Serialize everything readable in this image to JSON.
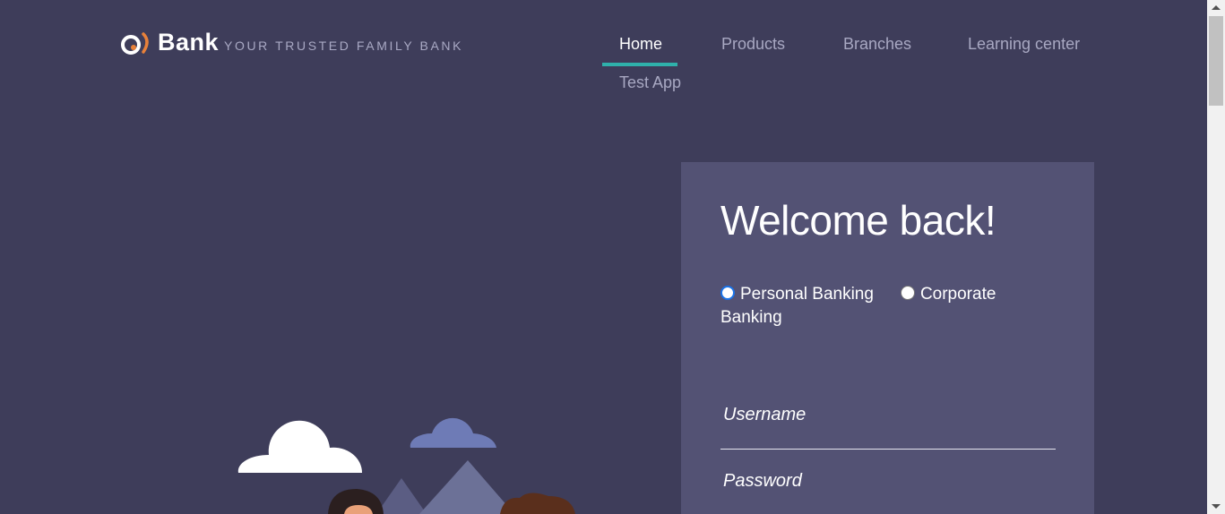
{
  "brand": {
    "name": "Bank",
    "tagline": "YOUR TRUSTED FAMILY BANK",
    "accent": "#e8813a"
  },
  "nav": {
    "items": [
      {
        "label": "Home",
        "active": true
      },
      {
        "label": "Products"
      },
      {
        "label": "Branches"
      },
      {
        "label": "Learning center"
      },
      {
        "label": "Test App"
      }
    ],
    "active_color": "#2fb1ab"
  },
  "login": {
    "heading": "Welcome back!",
    "options": {
      "personal": "Personal Banking",
      "corporate": "Corporate",
      "corporate_cont": "Banking",
      "selected": "personal"
    },
    "username_placeholder": "Username",
    "password_placeholder": "Password"
  },
  "colors": {
    "background": "#3e3d5a",
    "panel": "#535274"
  }
}
